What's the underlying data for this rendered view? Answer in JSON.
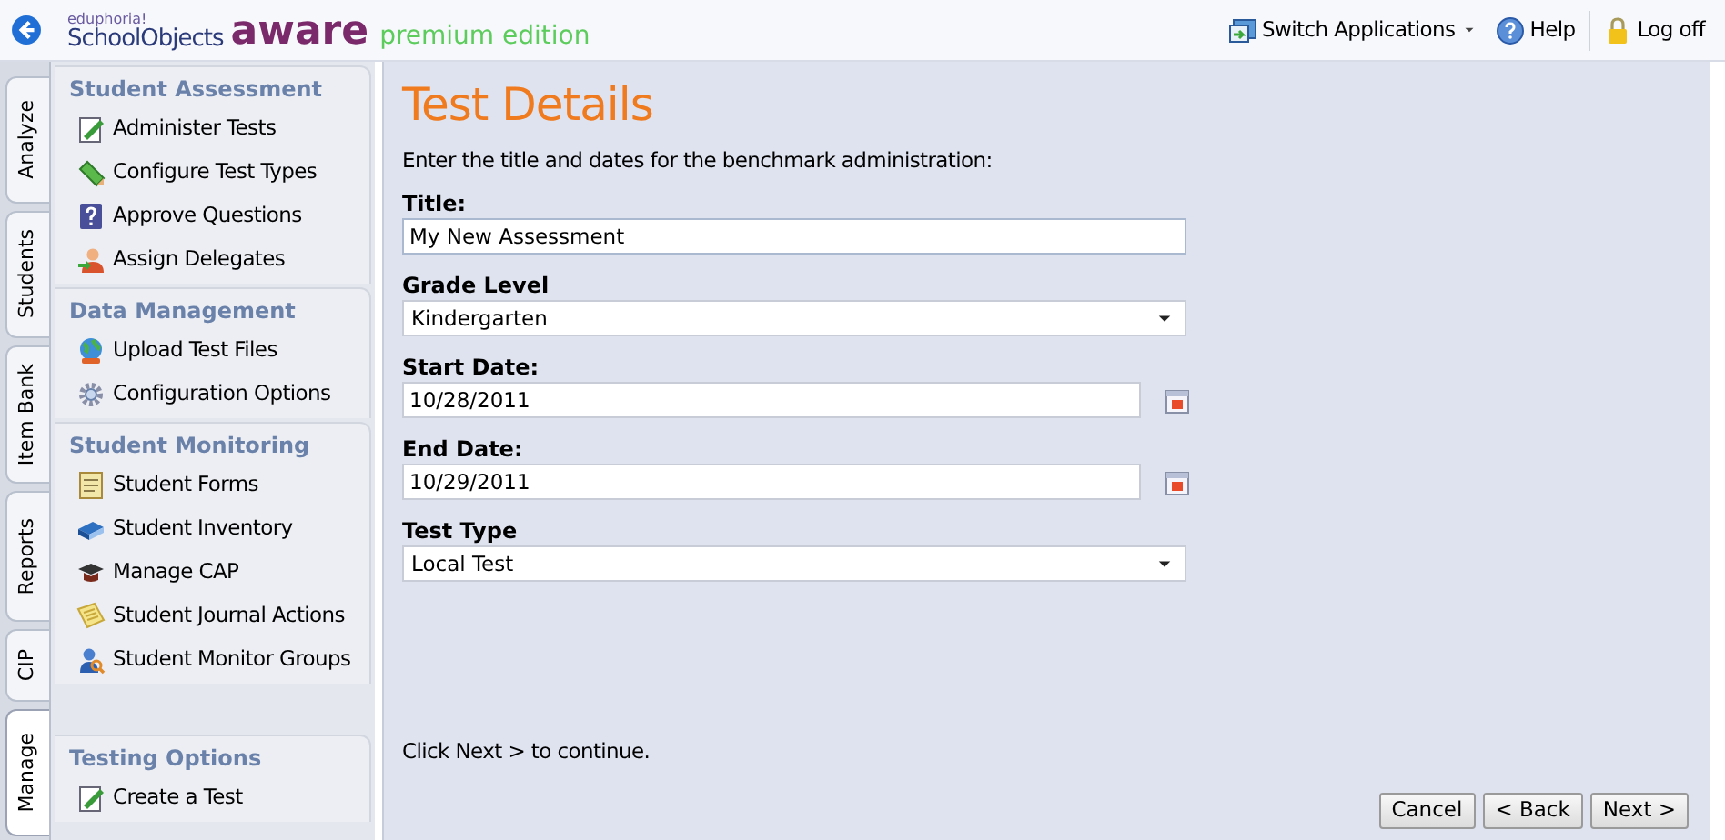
{
  "header": {
    "logo": {
      "small": "eduphoria!",
      "name": "SchoolObjects",
      "product": "aware",
      "edition": "premium edition"
    },
    "actions": [
      {
        "kind": "switch",
        "label": "Switch Applications"
      },
      {
        "kind": "help",
        "label": "Help"
      },
      {
        "kind": "logoff",
        "label": "Log off"
      }
    ]
  },
  "vertical_tabs": [
    {
      "label": "Analyze",
      "selected": false
    },
    {
      "label": "Students",
      "selected": false
    },
    {
      "label": "Item Bank",
      "selected": false
    },
    {
      "label": "Reports",
      "selected": false
    },
    {
      "label": "CIP",
      "selected": false
    },
    {
      "label": "Manage",
      "selected": true
    }
  ],
  "sidebar": [
    {
      "heading": "Student Assessment",
      "items": [
        {
          "label": "Administer Tests"
        },
        {
          "label": "Configure Test Types"
        },
        {
          "label": "Approve Questions"
        },
        {
          "label": "Assign Delegates"
        }
      ]
    },
    {
      "heading": "Data Management",
      "items": [
        {
          "label": "Upload Test Files"
        },
        {
          "label": "Configuration Options"
        }
      ]
    },
    {
      "heading": "Student Monitoring",
      "items": [
        {
          "label": "Student Forms"
        },
        {
          "label": "Student Inventory"
        },
        {
          "label": "Manage CAP"
        },
        {
          "label": "Student Journal Actions"
        },
        {
          "label": "Student Monitor Groups"
        }
      ]
    },
    {
      "heading": "Testing Options",
      "items": [
        {
          "label": "Create a Test"
        }
      ]
    }
  ],
  "main": {
    "title": "Test Details",
    "instructions": "Enter the title and dates for the benchmark administration:",
    "fields": [
      {
        "kind": "text",
        "label": "Title:",
        "value": "My New Assessment"
      },
      {
        "kind": "select",
        "label": "Grade Level",
        "value": "Kindergarten"
      },
      {
        "kind": "date",
        "label": "Start Date:",
        "value": "10/28/2011"
      },
      {
        "kind": "date",
        "label": "End Date:",
        "value": "10/29/2011"
      },
      {
        "kind": "select",
        "label": "Test Type",
        "value": "Local Test"
      }
    ],
    "hint": "Click Next > to continue.",
    "buttons": [
      "Cancel",
      "< Back",
      "Next >"
    ]
  }
}
